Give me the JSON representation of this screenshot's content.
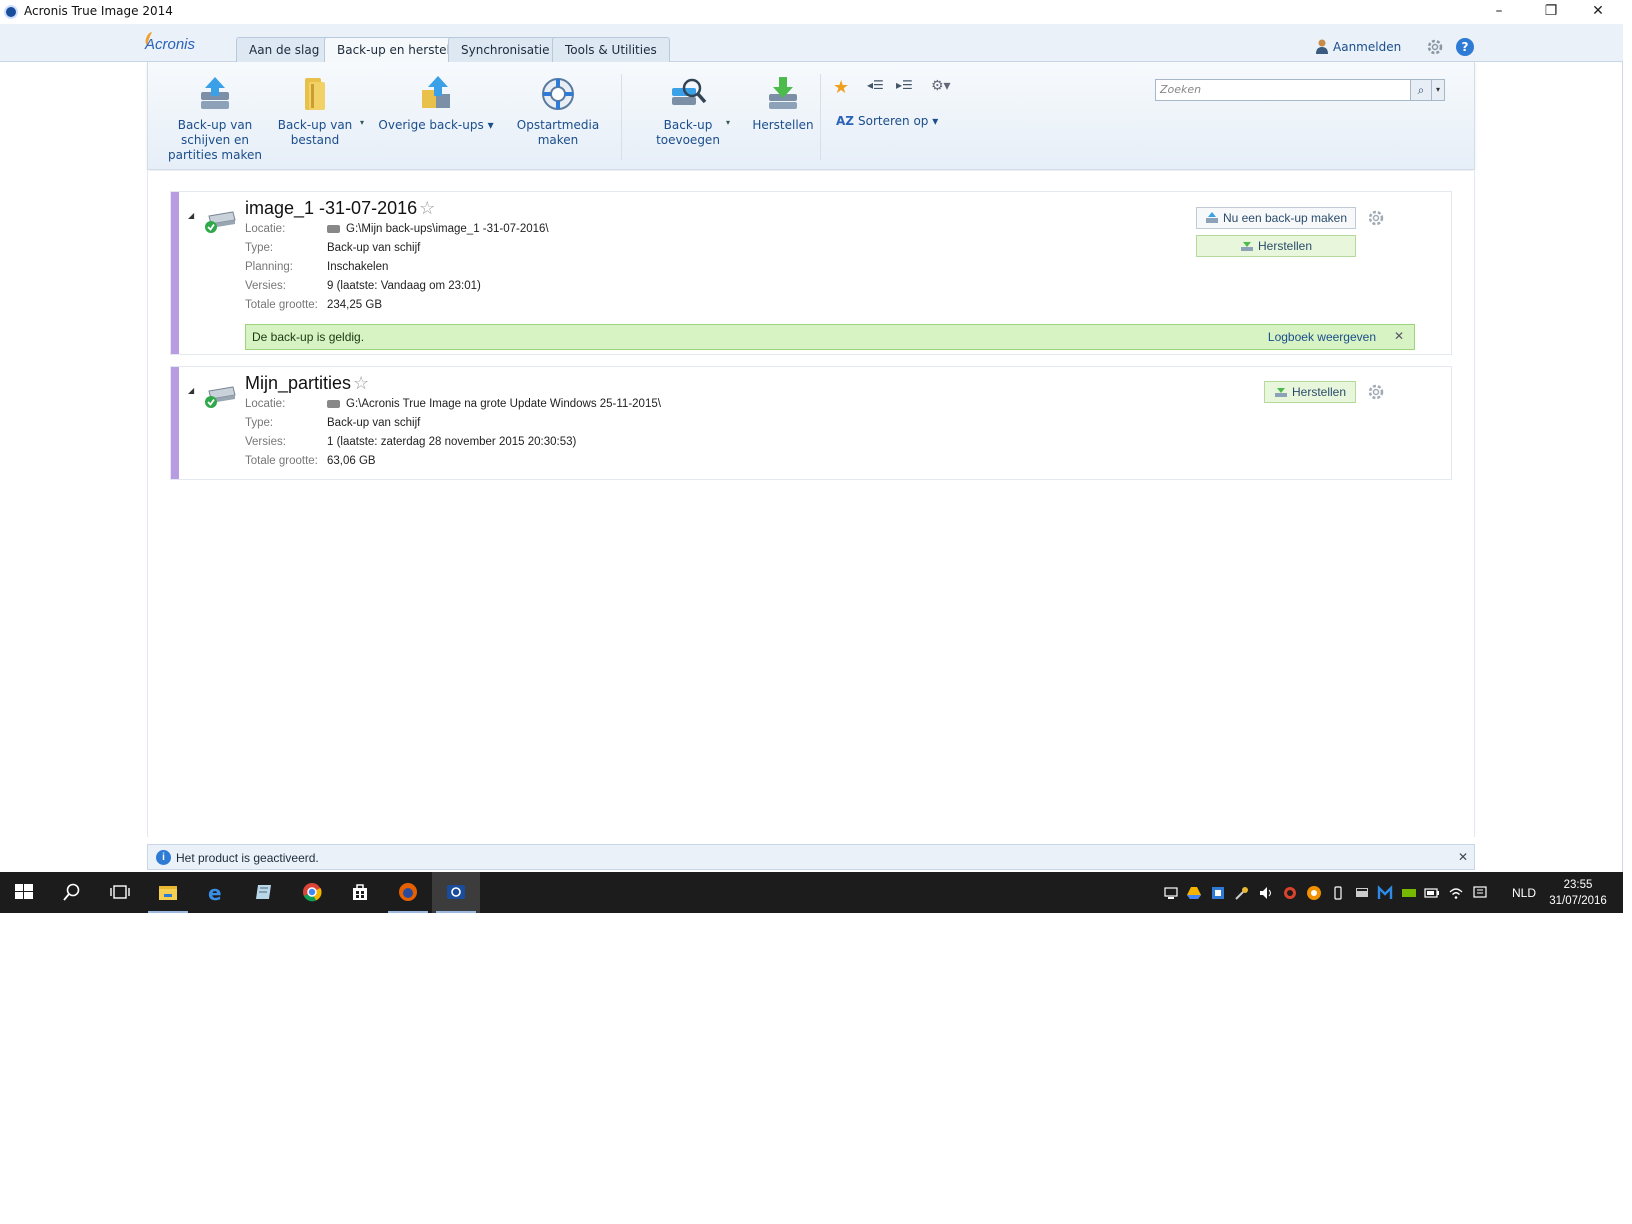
{
  "window": {
    "title": "Acronis True Image 2014",
    "minimize": "–",
    "maximize": "❐",
    "close": "✕"
  },
  "header": {
    "logo": "Acronis",
    "tabs": [
      {
        "label": "Aan de slag"
      },
      {
        "label": "Back-up en herstel"
      },
      {
        "label": "Synchronisatie"
      },
      {
        "label": "Tools & Utilities"
      }
    ],
    "active_tab": "Back-up en herstel",
    "login_label": "Aanmelden",
    "help_label": "?"
  },
  "toolbar": {
    "backup_disks_label": "Back-up van schijven en partities maken",
    "backup_file_label": "Back-up van bestand",
    "other_backups_label": "Overige back-ups",
    "boot_media_label": "Opstartmedia maken",
    "add_backup_label": "Back-up toevoegen",
    "restore_label": "Herstellen",
    "sort_label": "Sorteren op",
    "sort_glyph": "AZ",
    "dropdown_glyph": "▾",
    "search_placeholder": "Zoeken",
    "search_glyph": "⌕"
  },
  "backups": [
    {
      "name": "image_1 -31-07-2016",
      "location_label": "Locatie:",
      "location": "G:\\Mijn back-ups\\image_1 -31-07-2016\\",
      "type_label": "Type:",
      "type": "Back-up van schijf",
      "schedule_label": "Planning:",
      "schedule": "Inschakelen",
      "versions_label": "Versies:",
      "versions": "9 (laatste: Vandaag om 23:01)",
      "size_label": "Totale grootte:",
      "size": "234,25 GB",
      "status": "De back-up is geldig.",
      "log_link": "Logboek weergeven",
      "backup_now_label": "Nu een back-up maken",
      "restore_label": "Herstellen"
    },
    {
      "name": "Mijn_partities",
      "location_label": "Locatie:",
      "location": "G:\\Acronis True Image na grote Update Windows 25-11-2015\\",
      "type_label": "Type:",
      "type": "Back-up van schijf",
      "versions_label": "Versies:",
      "versions": "1 (laatste: zaterdag 28 november 2015 20:30:53)",
      "size_label": "Totale grootte:",
      "size": "63,06 GB",
      "restore_label": "Herstellen"
    }
  ],
  "status_bar": {
    "text": "Het product is geactiveerd.",
    "info_glyph": "i",
    "close_glyph": "✕"
  },
  "taskbar": {
    "language": "NLD",
    "time": "23:55",
    "date": "31/07/2016"
  },
  "colors": {
    "accent": "#2a63b8",
    "card_bar": "#b79ce3",
    "valid_bg": "#d7f2c3",
    "taskbar": "#1c1c1c"
  }
}
